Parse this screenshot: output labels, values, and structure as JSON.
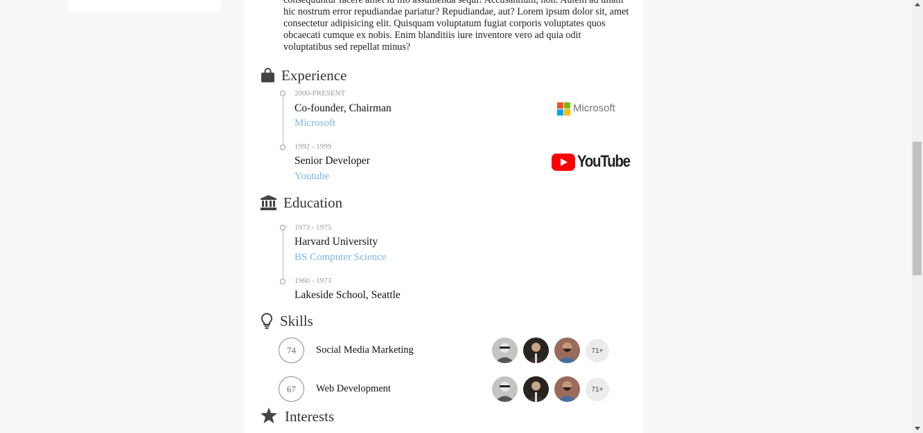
{
  "about_text": "consequuntur facere amet id illo assumenda sequi! Accusantium, non. Autem ad ullam hic nostrum error repudiandae pariatur? Repudiandae, aut? Lorem ipsum dolor sit, amet consectetur adipisicing elit. Quisquam voluptatum fugiat corporis voluptates quos obcaecati cumque ex nobis. Enim blanditiis iure inventore vero ad quia odit voluptatibus sed repellat minus?",
  "experience": {
    "title": "Experience",
    "items": [
      {
        "date": "2000-PRESENT",
        "role": "Co-founder, Chairman",
        "org": "Microsoft",
        "logo_text": "Microsoft"
      },
      {
        "date": "1992 - 1999",
        "role": "Senior Developer",
        "org": "Youtube",
        "logo_text": "YouTube"
      }
    ]
  },
  "education": {
    "title": "Education",
    "items": [
      {
        "date": "1973 - 1975",
        "school": "Harvard University",
        "degree": "BS Computer Science"
      },
      {
        "date": "1960 - 1973",
        "school": "Lakeside School, Seattle",
        "degree": ""
      }
    ]
  },
  "skills": {
    "title": "Skills",
    "items": [
      {
        "score": "74",
        "name": "Social Media Marketing",
        "more": "71+"
      },
      {
        "score": "67",
        "name": "Web Development",
        "more": "71+"
      }
    ]
  },
  "interests": {
    "title": "Interests"
  },
  "colors": {
    "link": "#7ab6e0",
    "icon": "#444444"
  }
}
